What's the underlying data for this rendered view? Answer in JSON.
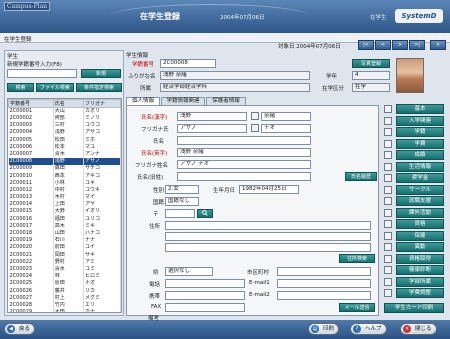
{
  "header": {
    "logo_left": "Campus-Plan",
    "title": "在学生登録",
    "date": "2004年07月06日",
    "subtitle": "在学生",
    "logo_right": "SystemD"
  },
  "breadcrumb": "在学生登録",
  "target": {
    "label": "対象日",
    "value": "2004年07月06日"
  },
  "nav": [
    "|<",
    "<",
    ">",
    ">|",
    "×"
  ],
  "search": {
    "section_label": "学生",
    "query_label": "新規学籍番号入力(F8)",
    "query_value": "",
    "new_button": "新規",
    "filter_buttons": [
      "検索",
      "ファイル検索",
      "条件指定検索"
    ]
  },
  "student_table": {
    "columns": [
      "学籍番号",
      "氏名",
      "フリガナ"
    ],
    "selected_index": 7,
    "rows": [
      [
        "2C00001",
        "大山",
        "カオリ"
      ],
      [
        "2C00002",
        "阿部",
        "ミノリ"
      ],
      [
        "2C00003",
        "三村",
        "ユウコ"
      ],
      [
        "2C00004",
        "浅野",
        "アサコ"
      ],
      [
        "2C00005",
        "松田",
        "ミホ"
      ],
      [
        "2C00006",
        "松本",
        "マユ"
      ],
      [
        "2C00007",
        "青木",
        "アンナ"
      ],
      [
        "2C00008",
        "浅野",
        "アサノ"
      ],
      [
        "2C00009",
        "森田",
        "サチコ"
      ],
      [
        "2C00010",
        "西本",
        "アキコ"
      ],
      [
        "2C00011",
        "小林",
        "ユキ"
      ],
      [
        "2C00012",
        "中村",
        "ユウキ"
      ],
      [
        "2C00013",
        "木村",
        "マイ"
      ],
      [
        "2C00014",
        "上田",
        "アヤ"
      ],
      [
        "2C00015",
        "大野",
        "イオリ"
      ],
      [
        "2C00016",
        "福田",
        "ユリコ"
      ],
      [
        "2C00017",
        "高木",
        "ミキ"
      ],
      [
        "2C00018",
        "山田",
        "ハナコ"
      ],
      [
        "2C00019",
        "石川",
        "ナナ"
      ],
      [
        "2C00020",
        "前田",
        "ユイ"
      ],
      [
        "2C00021",
        "岡田",
        "サキ"
      ],
      [
        "2C00022",
        "野村",
        "アミ"
      ],
      [
        "2C00023",
        "清水",
        "ユミ"
      ],
      [
        "2C00024",
        "林",
        "ヒロミ"
      ],
      [
        "2C00025",
        "原田",
        "ナオ"
      ],
      [
        "2C00026",
        "藤井",
        "リカ"
      ],
      [
        "2C00027",
        "村上",
        "メグミ"
      ],
      [
        "2C00028",
        "竹内",
        "エリ"
      ],
      [
        "2C00029",
        "太田",
        "カナ"
      ]
    ]
  },
  "info": {
    "section_label": "学生情報",
    "id_label": "学籍番号",
    "id_value": "2C00008",
    "name_kana_label": "ふりがな名",
    "name_kana_value": "浅野 奈緒",
    "affiliation_label": "所属",
    "affiliation_value": "経済学部経済学科",
    "grade_label": "学年",
    "grade_value": "4",
    "status_label": "在学区分",
    "status_value": "在学",
    "photo_button": "写真登録"
  },
  "tabs": [
    "個人情報",
    "学籍情報関連",
    "保護者情報"
  ],
  "form": {
    "name_kanji_label": "氏名(漢字)",
    "name_kanji_last": "浅野",
    "name_kanji_first": "奈緒",
    "furigana_label": "フリガナ氏",
    "furigana_last": "アサノ",
    "furigana_first": "ナオ",
    "name_label": "氏名",
    "name_roman_label": "氏名(英字)",
    "name_roman_value": "浅野 奈緒",
    "furigana_full_label": "フリガナ姓名",
    "furigana_full_value": "アサノ ナオ",
    "alias_label": "氏名(旧姓)",
    "alias_button": "氏名履歴",
    "gender_label": "性別",
    "gender_value": "2:女",
    "birth_label": "生年月日",
    "birth_value": "1982年04月25日",
    "nationality_label": "国籍",
    "nationality_value": "国籍なし",
    "zip_label": "〒",
    "address_label": "住所",
    "addr_button": "住所検索",
    "pref_label": "県",
    "pref_value": "選択なし",
    "city_label": "市区町村",
    "tel_label": "電話",
    "mobile_label": "携帯",
    "fax_label": "FAX",
    "email1_label": "E-mail1",
    "email2_label": "E-mail2",
    "mail_button": "メール送信",
    "note_label": "備考"
  },
  "side_buttons": [
    "基本",
    "入学関連",
    "学籍",
    "学費",
    "成績",
    "生活情報",
    "奨学金",
    "サークル",
    "就職支援",
    "課外活動",
    "資格",
    "保健",
    "異動",
    "資格取得",
    "健康診断",
    "学部所属",
    "学費調整"
  ],
  "side_bottom_button": "学生カード印刷",
  "footer": {
    "back": "戻る",
    "print": "印刷",
    "help": "ヘルプ",
    "close": "閉じる"
  }
}
